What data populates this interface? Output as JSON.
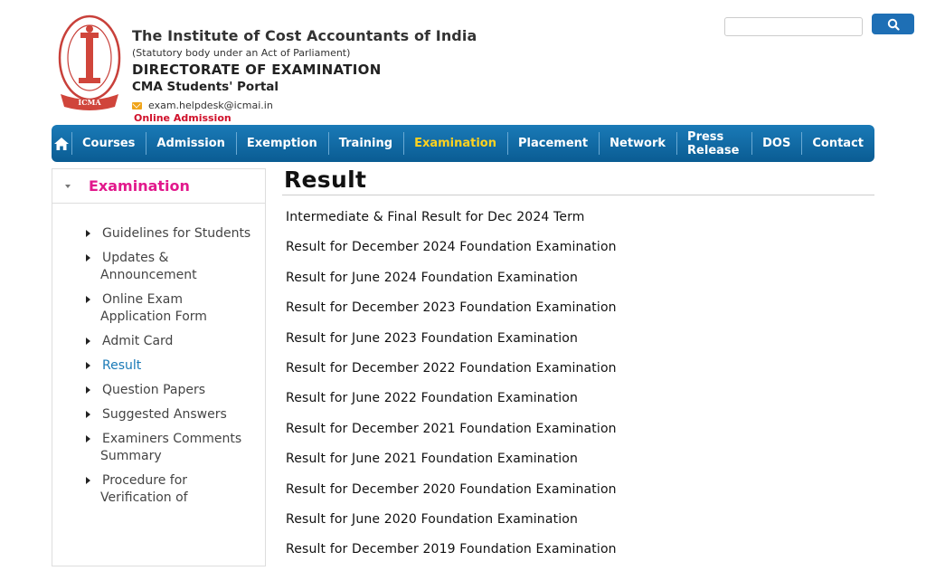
{
  "header": {
    "org_name": "The Institute of Cost Accountants of India",
    "org_sub": "(Statutory body under an Act of Parliament)",
    "directorate": "DIRECTORATE OF EXAMINATION",
    "portal": "CMA Students' Portal",
    "email": "exam.helpdesk@icmai.in",
    "online_admission": "Online Admission",
    "logo_icon": "icmai-seal-logo"
  },
  "search": {
    "placeholder": "",
    "icon": "search-icon"
  },
  "nav": {
    "home_icon": "home-icon",
    "items": [
      "Courses",
      "Admission",
      "Exemption",
      "Training",
      "Examination",
      "Placement",
      "Network",
      "Press Release",
      "DOS",
      "Contact"
    ],
    "active": "Examination"
  },
  "sidebar": {
    "title": "Examination",
    "items": [
      "Guidelines for Students",
      "Updates & Announcement",
      "Online Exam Application Form",
      "Admit Card",
      "Result",
      "Question Papers",
      "Suggested Answers",
      "Examiners Comments Summary",
      "Procedure for Verification of"
    ],
    "active": "Result"
  },
  "main": {
    "title": "Result",
    "results": [
      "Intermediate & Final Result for Dec 2024 Term",
      "Result for December 2024 Foundation Examination",
      "Result for June 2024 Foundation Examination",
      "Result for December 2023 Foundation Examination",
      "Result for June 2023 Foundation Examination",
      "Result for December 2022 Foundation Examination",
      "Result for June 2022 Foundation Examination",
      "Result for December 2021 Foundation Examination",
      "Result for June 2021 Foundation Examination",
      "Result for December 2020 Foundation Examination",
      "Result for June 2020 Foundation Examination",
      "Result for December 2019 Foundation Examination"
    ]
  },
  "colors": {
    "nav_blue": "#1a7ab7",
    "active_yellow": "#ffd21f",
    "sidebar_pink": "#e2188c",
    "admission_red": "#d0112b"
  }
}
